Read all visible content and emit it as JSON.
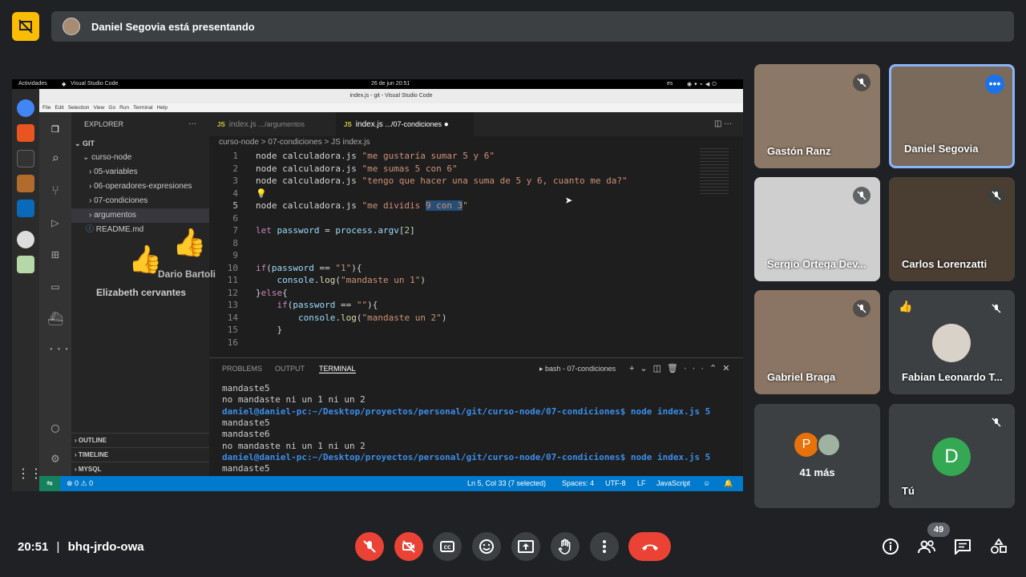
{
  "meet": {
    "presenting_text": "Daniel Segovia está presentando",
    "clock": "20:51",
    "separator": "|",
    "meeting_code": "bhq-jrdo-owa",
    "participants_badge": "49"
  },
  "ubuntu": {
    "activities": "Actividades",
    "app": "Visual Studio Code",
    "date": "26 de jun  20:51",
    "lang": "es"
  },
  "vscode": {
    "window_title": "index.js - git - Visual Studio Code",
    "menu": [
      "File",
      "Edit",
      "Selection",
      "View",
      "Go",
      "Run",
      "Terminal",
      "Help"
    ],
    "explorer_title": "EXPLORER",
    "explorer_more": "···",
    "tree": [
      "GIT",
      "curso-node",
      "05-variables",
      "06-operadores-expresiones",
      "07-condiciones",
      "argumentos",
      "README.md"
    ],
    "outline": "OUTLINE",
    "timeline": "TIMELINE",
    "mysql": "MYSQL",
    "tab1_label": "index.js",
    "tab1_path": ".../argumentos",
    "tab2_label": "index.js",
    "tab2_path": ".../07-condiciones",
    "js_badge": "JS",
    "crumbs": "curso-node  >  07-condiciones  >  JS index.js",
    "panel_tabs": [
      "PROBLEMS",
      "OUTPUT",
      "TERMINAL"
    ],
    "terminal_name": "bash - 07-condiciones",
    "terminal_lines": [
      "mandaste5",
      "no mandaste ni un 1 ni un 2",
      "daniel@daniel-pc:~/Desktop/proyectos/personal/git/curso-node/07-condiciones$ node index.js 5",
      "mandaste5",
      "mandaste6",
      "no mandaste ni un 1 ni un 2",
      "daniel@daniel-pc:~/Desktop/proyectos/personal/git/curso-node/07-condiciones$ node index.js 5",
      "mandaste5"
    ],
    "status_errors": "⊗ 0 ⚠ 0",
    "status_pos": "Ln 5, Col 33 (7 selected)",
    "status_spaces": "Spaces: 4",
    "status_enc": "UTF-8",
    "status_eol": "LF",
    "status_lang": "JavaScript"
  },
  "reactions": {
    "name1": "Dario Bartoli",
    "name2": "Elizabeth cervantes"
  },
  "tiles": [
    {
      "name": "Gastón Ranz",
      "color": "#8b7866"
    },
    {
      "name": "Daniel Segovia",
      "color": "#7a6a5c"
    },
    {
      "name": "Sergio Ortega Dev...",
      "color": "#cfcfcf"
    },
    {
      "name": "Carlos Lorenzatti",
      "color": "#4a3e32"
    },
    {
      "name": "Gabriel Braga",
      "color": "#8a7564"
    },
    {
      "name": "Fabian Leonardo T...",
      "color": "#3c4043"
    },
    {
      "name": "41 más",
      "color": "#3c4043"
    },
    {
      "name": "Tú",
      "color": "#3c4043"
    }
  ],
  "avatars": {
    "p": "P",
    "d": "D"
  },
  "accent": "#8ab4f8",
  "danger": "#ea4335"
}
